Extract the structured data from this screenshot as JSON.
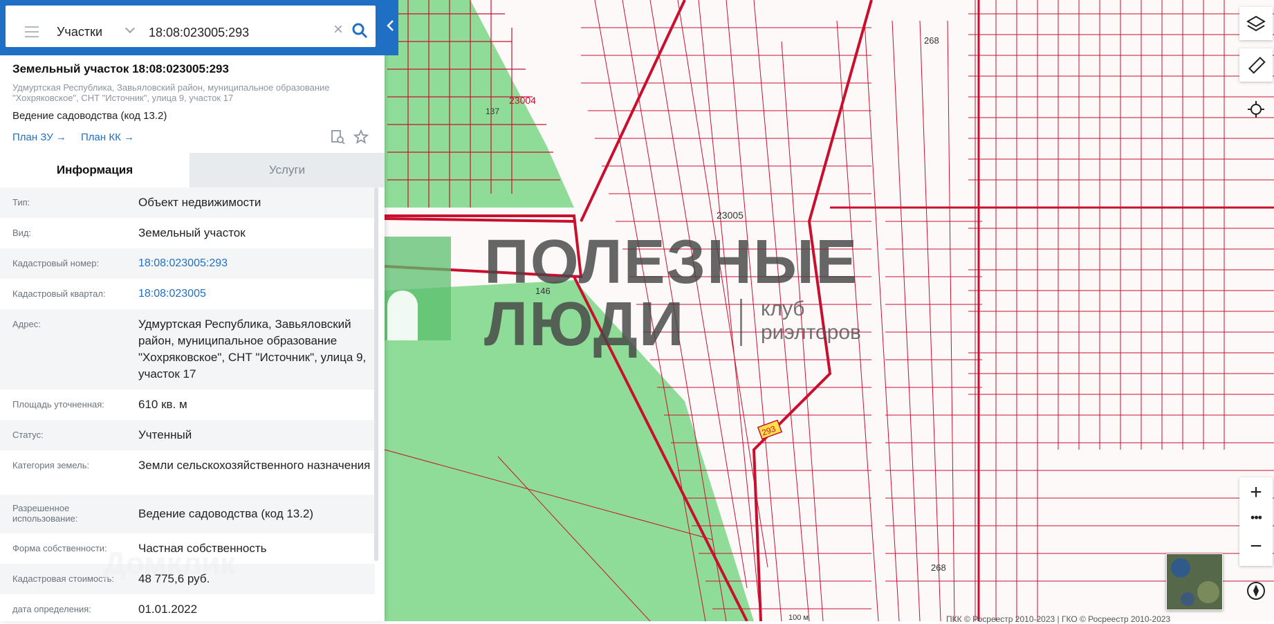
{
  "search": {
    "type_label": "Участки",
    "value": "18:08:023005:293"
  },
  "object": {
    "title": "Земельный участок 18:08:023005:293",
    "address_short": "Удмуртская Республика, Завьяловский район, муниципальное образование \"Хохряковское\", СНТ \"Источник\", улица 9, участок 17",
    "use": "Ведение садоводства (код 13.2)",
    "plan_zu": "План ЗУ",
    "plan_kk": "План КК"
  },
  "tabs": {
    "info": "Информация",
    "services": "Услуги"
  },
  "rows": [
    {
      "key": "Тип:",
      "value": "Объект недвижимости"
    },
    {
      "key": "Вид:",
      "value": "Земельный участок"
    },
    {
      "key": "Кадастровый номер:",
      "value": "18:08:023005:293"
    },
    {
      "key": "Кадастровый квартал:",
      "value": "18:08:023005"
    },
    {
      "key": "Адрес:",
      "value": "Удмуртская Республика, Завьяловский район, муниципальное образование \"Хохряковское\", СНТ \"Источник\", улица 9, участок 17"
    },
    {
      "key": "Площадь уточненная:",
      "value": "610 кв. м"
    },
    {
      "key": "Статус:",
      "value": "Учтенный"
    },
    {
      "key": "Категория земель:",
      "value": "Земли сельскохозяйственного назначения"
    },
    {
      "key": "Разрешенное использование:",
      "value": "Ведение садоводства (код 13.2)"
    },
    {
      "key": "Форма собственности:",
      "value": "Частная собственность"
    },
    {
      "key": "Кадастровая стоимость:",
      "value": "48 775,6 руб."
    },
    {
      "key": "дата определения:",
      "value": "01.01.2022"
    }
  ],
  "map": {
    "quarter_labels": [
      "23004",
      "23005",
      "146",
      "137",
      "268",
      "268"
    ],
    "highlight_label": "293",
    "copyright": "ПКК © Росреестр 2010-2023 | ГКО © Росреестр 2010-2023",
    "scale": "100 м"
  },
  "watermark": {
    "line1": "ПОЛЕЗНЫЕ",
    "line2": "ЛЮДИ",
    "sub1": "клуб",
    "sub2": "риэлторов",
    "domclick": "Домклик"
  },
  "colors": {
    "accent": "#1f6fc5",
    "parcel": "#c8102e",
    "forest": "#8fdc98"
  }
}
